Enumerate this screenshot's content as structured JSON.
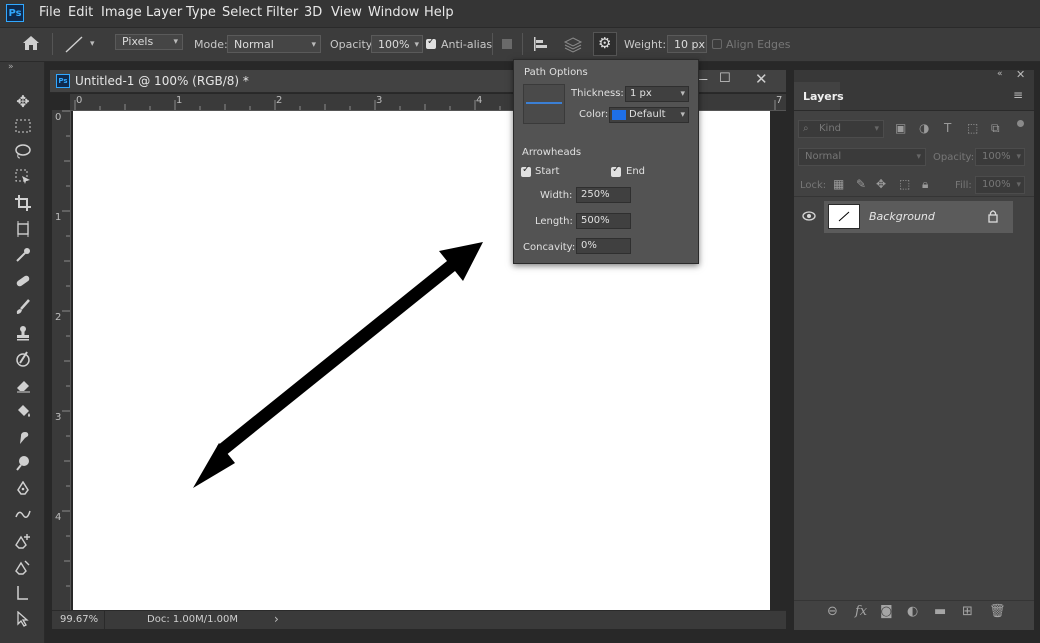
{
  "menubar": {
    "logo": "Ps",
    "items": [
      "File",
      "Edit",
      "Image",
      "Layer",
      "Type",
      "Select",
      "Filter",
      "3D",
      "View",
      "Window",
      "Help"
    ]
  },
  "options": {
    "pixels": "Pixels",
    "mode_label": "Mode:",
    "mode_value": "Normal",
    "opacity_label": "Opacity:",
    "opacity_value": "100%",
    "antialias_label": "Anti-alias",
    "weight_label": "Weight:",
    "weight_value": "10 px",
    "align_edges_label": "Align Edges"
  },
  "document": {
    "title": "Untitled-1 @ 100% (RGB/8) *",
    "ruler_h": [
      "0",
      "1",
      "2",
      "3",
      "4",
      "7"
    ],
    "ruler_v": [
      "0",
      "1",
      "2",
      "3",
      "4"
    ],
    "zoom": "99.67%",
    "doc_info": "Doc: 1.00M/1.00M"
  },
  "path_options": {
    "title": "Path Options",
    "thickness_label": "Thickness:",
    "thickness_value": "1 px",
    "color_label": "Color:",
    "color_value": "Default",
    "color_swatch": "#1e6fe8",
    "arrowheads_label": "Arrowheads",
    "start_label": "Start",
    "end_label": "End",
    "width_label": "Width:",
    "width_value": "250%",
    "length_label": "Length:",
    "length_value": "500%",
    "concavity_label": "Concavity:",
    "concavity_value": "0%"
  },
  "layers": {
    "tab_label": "Layers",
    "kind_placeholder": "Kind",
    "blend_mode": "Normal",
    "opacity_label": "Opacity:",
    "opacity_value": "100%",
    "lock_label": "Lock:",
    "fill_label": "Fill:",
    "fill_value": "100%",
    "layer_name": "Background"
  }
}
